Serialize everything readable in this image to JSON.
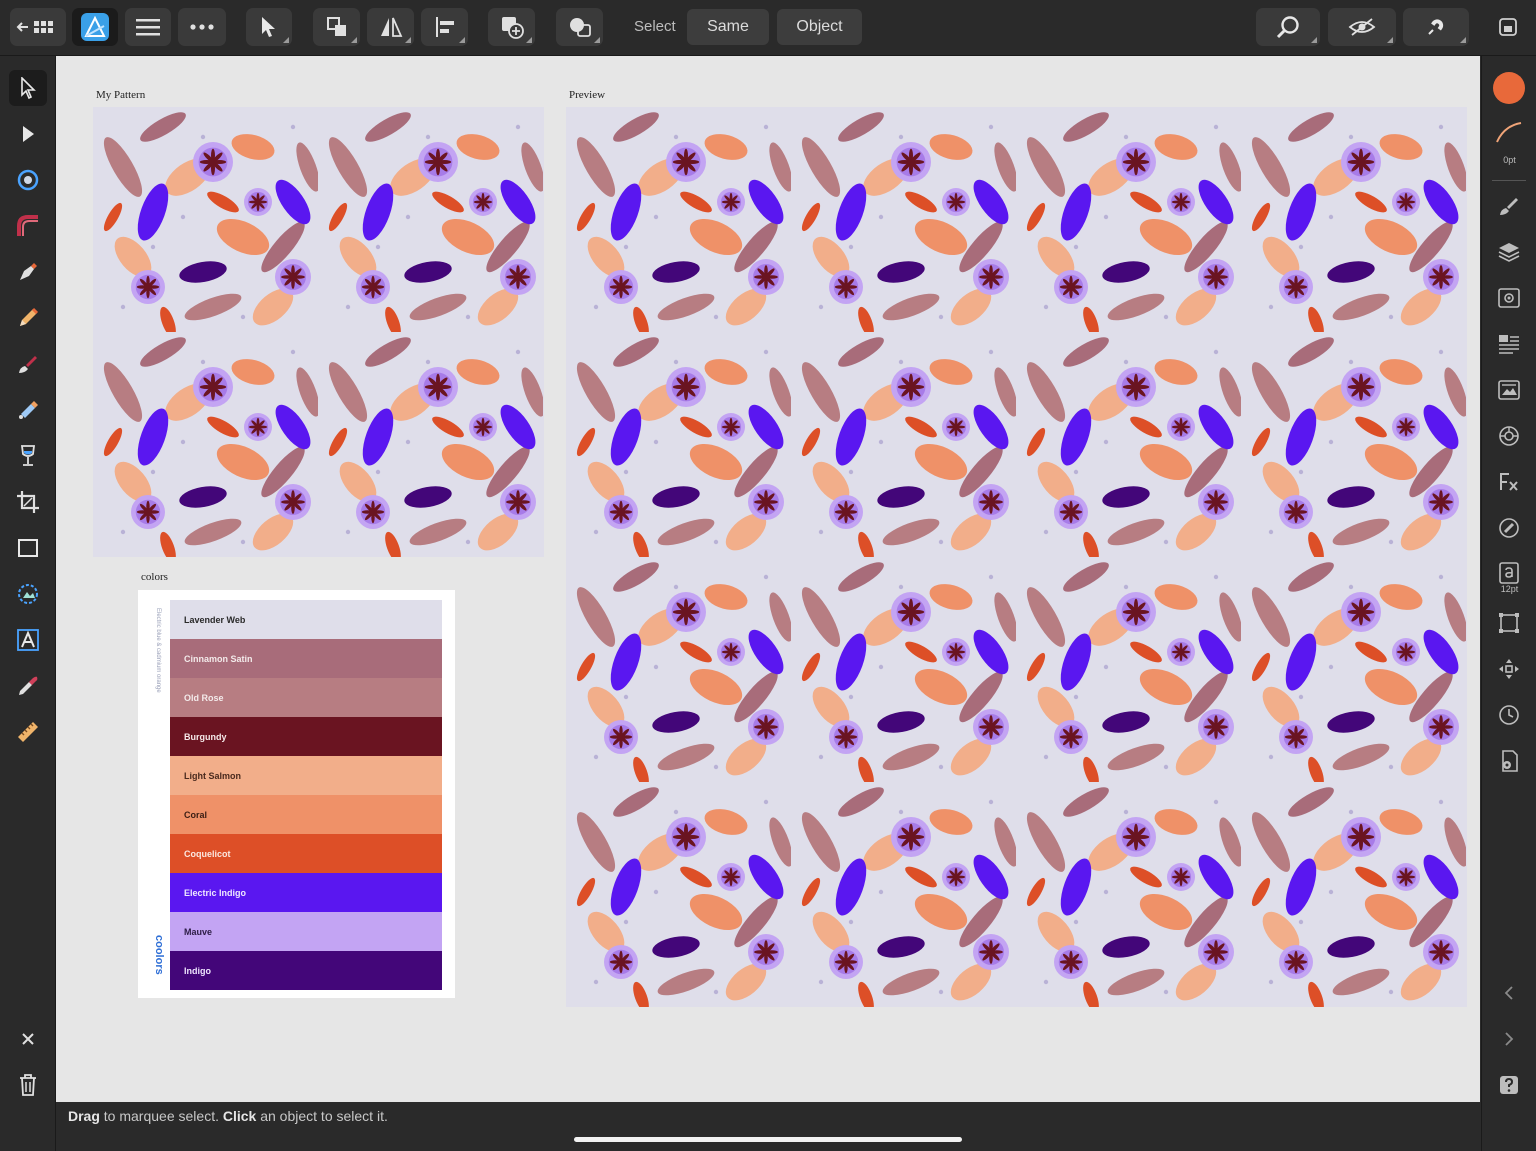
{
  "toolbar": {
    "select_label": "Select",
    "same_label": "Same",
    "object_label": "Object"
  },
  "artboards": {
    "pattern_label": "My Pattern",
    "preview_label": "Preview",
    "colors_label": "colors"
  },
  "palette": {
    "side_caption": "Electric blue & cadmium orange",
    "brand": "coolors",
    "swatches": [
      {
        "name": "Lavender Web",
        "color": "#dfdeea",
        "text": "#2a2a2a"
      },
      {
        "name": "Cinnamon Satin",
        "color": "#a86c7a",
        "text": "#f3eaea"
      },
      {
        "name": "Old Rose",
        "color": "#b77d82",
        "text": "#f3eaea"
      },
      {
        "name": "Burgundy",
        "color": "#6a1421",
        "text": "#f6eaea"
      },
      {
        "name": "Light Salmon",
        "color": "#f2ae8a",
        "text": "#4a2a1e"
      },
      {
        "name": "Coral",
        "color": "#ef9168",
        "text": "#3a1e14"
      },
      {
        "name": "Coquelicot",
        "color": "#dd4f27",
        "text": "#fbe9e2"
      },
      {
        "name": "Electric Indigo",
        "color": "#5a17f0",
        "text": "#efe8ff"
      },
      {
        "name": "Mauve",
        "color": "#c3a4f3",
        "text": "#2d1d45"
      },
      {
        "name": "Indigo",
        "color": "#430679",
        "text": "#efe6ff"
      }
    ]
  },
  "rightpanel": {
    "stroke_width": "0pt",
    "font_size": "12pt"
  },
  "status": {
    "drag": "Drag",
    "drag_rest": " to marquee select. ",
    "click": "Click",
    "click_rest": " an object to select it."
  },
  "colors": {
    "accent_fill": "#e8693a",
    "ui_dark": "#2a2a2a",
    "canvas_bg": "#e6e6e6"
  }
}
